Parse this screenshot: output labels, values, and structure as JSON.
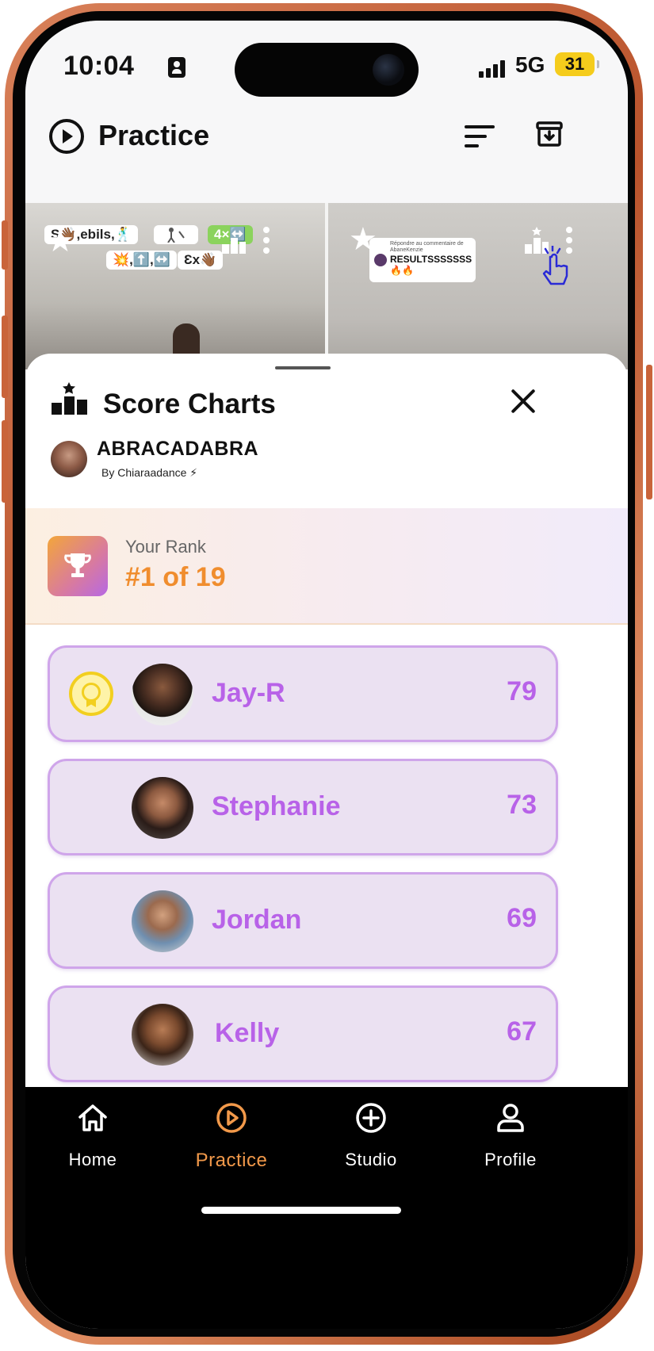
{
  "status_bar": {
    "time": "10:04",
    "network": "5G",
    "battery": "31"
  },
  "header": {
    "title": "Practice"
  },
  "video_stickers": {
    "left_1": "S👋🏾,ebils,🕺",
    "left_3": "4×↔️",
    "left_4": "💥,⬆️,↔️",
    "left_5": "Ɛx👋🏾",
    "comment_small": "Répondre au commentaire de AbaneKenzie",
    "comment_text": "RESULTSSSSSSS🔥🔥"
  },
  "sheet": {
    "title": "Score Charts",
    "song_title": "ABRACADABRA",
    "song_author": "By Chiaraadance ⚡"
  },
  "rank": {
    "label": "Your Rank",
    "value": "#1 of 19"
  },
  "leaderboard": [
    {
      "name": "Jay-R",
      "score": "79",
      "avatar_color": "#3b2a22"
    },
    {
      "name": "Stephanie",
      "score": "73",
      "avatar_color": "#5a3b2e"
    },
    {
      "name": "Jordan",
      "score": "69",
      "avatar_color": "#6b4b3a"
    },
    {
      "name": "Kelly",
      "score": "67",
      "avatar_color": "#7a5238"
    }
  ],
  "tabs": [
    {
      "label": "Home",
      "icon": "home-icon"
    },
    {
      "label": "Practice",
      "icon": "play-circle-icon"
    },
    {
      "label": "Studio",
      "icon": "plus-circle-icon"
    },
    {
      "label": "Profile",
      "icon": "person-icon"
    }
  ],
  "colors": {
    "accent_orange": "#f2994a",
    "accent_purple": "#b862e8",
    "row_background": "#ebe1f2",
    "row_border": "#cfa5ea",
    "medal_gold": "#f2cf1f",
    "frame_copper": "#c9643a"
  }
}
